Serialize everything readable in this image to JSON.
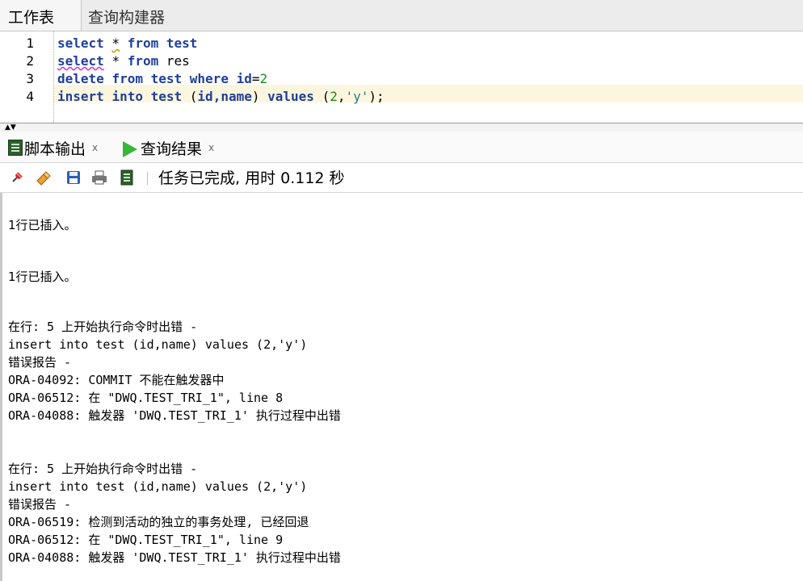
{
  "tabs": [
    {
      "label": "工作表"
    },
    {
      "label": "查询构建器"
    }
  ],
  "editor": {
    "lines": [
      {
        "num": "1",
        "text": "select * from test"
      },
      {
        "num": "2",
        "text": "select * from res"
      },
      {
        "num": "3",
        "text": "delete from test where id=2"
      },
      {
        "num": "4",
        "text": "insert into test (id,name) values (2,'y');"
      }
    ],
    "tokens": {
      "select": "select",
      "star": "*",
      "from": "from",
      "test": "test",
      "res": "res",
      "delete": "delete",
      "where": "where",
      "id": "id",
      "eq": "=",
      "two": "2",
      "insert": "insert",
      "into": "into",
      "open_paren": "(",
      "cols": "id,name",
      "close_paren": ")",
      "values": "values",
      "comma": ",",
      "y": "'y'",
      "end": ");"
    }
  },
  "output_tabs": [
    {
      "label": "脚本输出",
      "close": "x",
      "icon": "script-output-icon"
    },
    {
      "label": "查询结果",
      "close": "x",
      "icon": "run-icon"
    }
  ],
  "toolbar": {
    "icons": [
      "pin-icon",
      "eraser-icon",
      "save-icon",
      "print-icon",
      "script-icon"
    ],
    "status": "任务已完成, 用时 0.112 秒"
  },
  "output": {
    "lines": [
      "1行已插入。",
      "1行已插入。",
      "在行: 5 上开始执行命令时出错 -",
      "insert into test (id,name) values (2,'y')",
      "错误报告 -",
      "ORA-04092: COMMIT 不能在触发器中",
      "ORA-06512: 在 \"DWQ.TEST_TRI_1\", line 8",
      "ORA-04088: 触发器 'DWQ.TEST_TRI_1' 执行过程中出错",
      "在行: 5 上开始执行命令时出错 -",
      "insert into test (id,name) values (2,'y')",
      "错误报告 -",
      "ORA-06519: 检测到活动的独立的事务处理, 已经回退",
      "ORA-06512: 在 \"DWQ.TEST_TRI_1\", line 9",
      "ORA-04088: 触发器 'DWQ.TEST_TRI_1' 执行过程中出错"
    ]
  },
  "colors": {
    "keyword": "#1f3f9a",
    "number": "#1a8a1a",
    "string": "#2b7a7a",
    "current_line": "#fdf6df"
  }
}
